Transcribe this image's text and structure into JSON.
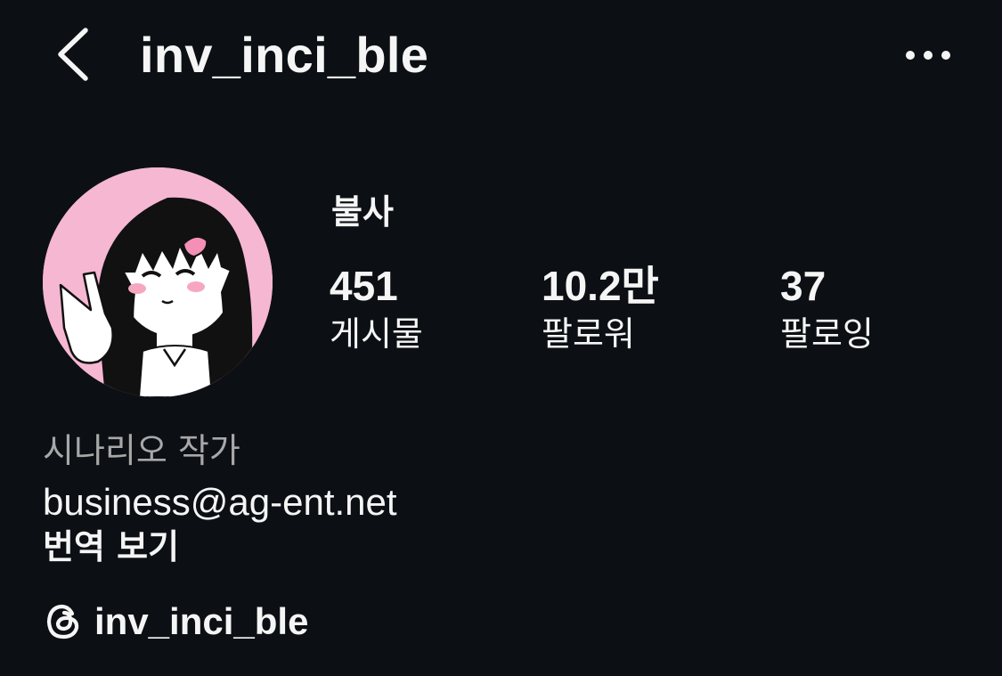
{
  "header": {
    "username": "inv_inci_ble",
    "back_icon": "chevron-left-icon",
    "more_icon": "more-horizontal-icon"
  },
  "profile": {
    "display_name": "불사",
    "avatar_accent": "#f6b7d3",
    "stats": {
      "posts": {
        "value": "451",
        "label": "게시물"
      },
      "followers": {
        "value": "10.2만",
        "label": "팔로워"
      },
      "following": {
        "value": "37",
        "label": "팔로잉"
      }
    }
  },
  "bio": {
    "category": "시나리오 작가",
    "email": "business@ag-ent.net",
    "translate_label": "번역 보기"
  },
  "threads": {
    "icon": "threads-icon",
    "handle": "inv_inci_ble"
  },
  "colors": {
    "background": "#0c1014",
    "text_primary": "#f5f5f5",
    "text_secondary": "#a8a8a8"
  }
}
